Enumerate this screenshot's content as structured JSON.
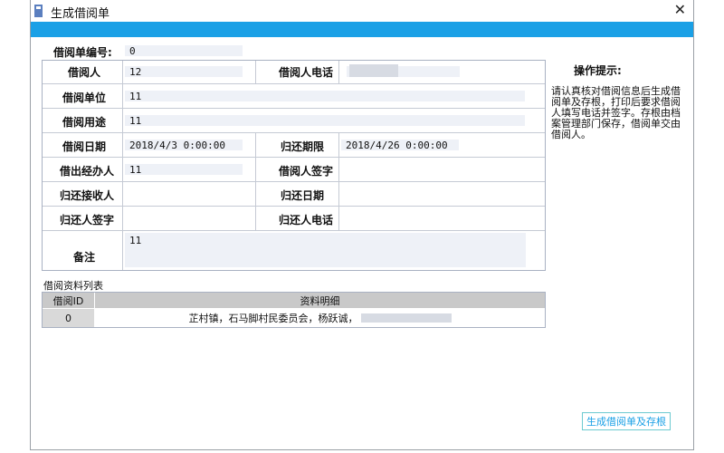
{
  "window": {
    "title": "生成借阅单"
  },
  "form": {
    "borrow_no_label": "借阅单编号:",
    "borrow_no_value": "0",
    "borrower_label": "借阅人",
    "borrower_value": "12",
    "borrower_phone_label": "借阅人电话",
    "borrower_phone_value": "",
    "unit_label": "借阅单位",
    "unit_value": "11",
    "purpose_label": "借阅用途",
    "purpose_value": "11",
    "borrow_date_label": "借阅日期",
    "borrow_date_value": "2018/4/3 0:00:00",
    "return_deadline_label": "归还期限",
    "return_deadline_value": "2018/4/26 0:00:00",
    "handler_label": "借出经办人",
    "handler_value": "11",
    "borrower_sign_label": "借阅人签字",
    "borrower_sign_value": "",
    "return_receiver_label": "归还接收人",
    "return_receiver_value": "",
    "return_date_label": "归还日期",
    "return_date_value": "",
    "returner_sign_label": "归还人签字",
    "returner_sign_value": "",
    "returner_phone_label": "归还人电话",
    "returner_phone_value": "",
    "remark_label": "备注",
    "remark_value": "11"
  },
  "tips": {
    "title": "操作提示:",
    "text": "请认真核对借阅信息后生成借阅单及存根，打印后要求借阅人填写电话并签字。存根由档案管理部门保存，借阅单交由借阅人。"
  },
  "materials": {
    "label": "借阅资料列表",
    "columns": [
      "借阅ID",
      "资料明细"
    ],
    "rows": [
      {
        "id": "0",
        "detail": "芷村镇，石马脚村民委员会，杨跃诚，"
      }
    ]
  },
  "buttons": {
    "generate": "生成借阅单及存根"
  },
  "colors": {
    "accent": "#1aa0e6",
    "header_gray": "#c9c9c9"
  }
}
